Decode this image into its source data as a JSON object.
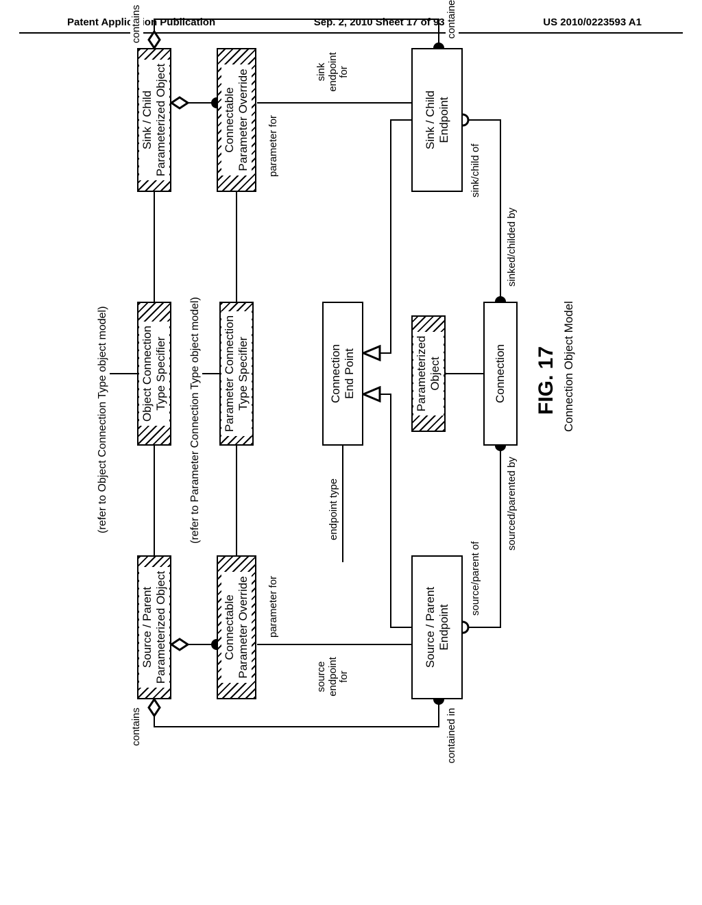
{
  "header": {
    "left": "Patent Application Publication",
    "center": "Sep. 2, 2010  Sheet 17 of 93",
    "right": "US 2010/0223593 A1"
  },
  "boxes": {
    "source_parent_param_obj": "Source / Parent\nParameterized Object",
    "sink_child_param_obj": "Sink / Child\nParameterized Object",
    "obj_conn_type_spec": "Object Connection\nType Specifier",
    "connectable_param_override_left": "Connectable\nParameter Override",
    "connectable_param_override_right": "Connectable\nParameter Override",
    "param_conn_type_spec": "Parameter Connection\nType Specifier",
    "connection_endpoint": "Connection\nEnd Point",
    "parameterized_object": "Parameterized\nObject",
    "source_parent_endpoint": "Source / Parent\nEndpoint",
    "sink_child_endpoint": "Sink / Child\nEndpoint",
    "connection": "Connection"
  },
  "labels": {
    "contains_left": "contains",
    "contains_right": "contains",
    "contained_in_left": "contained in",
    "contained_in_right": "contained in",
    "param_for_left": "parameter for",
    "param_for_right": "parameter for",
    "source_endpoint_for": "source\nendpoint\nfor",
    "sink_endpoint_for": "sink\nendpoint\nfor",
    "endpoint_type": "endpoint type",
    "source_parent_of": "source/parent of",
    "sink_child_of": "sink/child of",
    "sourced_parented_by": "sourced/parented by",
    "sinked_childed_by": "sinked/childed by",
    "refer_obj_conn": "(refer to Object Connection Type object model)",
    "refer_param_conn": "(refer to Parameter Connection Type object model)"
  },
  "figure": {
    "label": "FIG. 17",
    "subtitle": "Connection Object Model"
  }
}
